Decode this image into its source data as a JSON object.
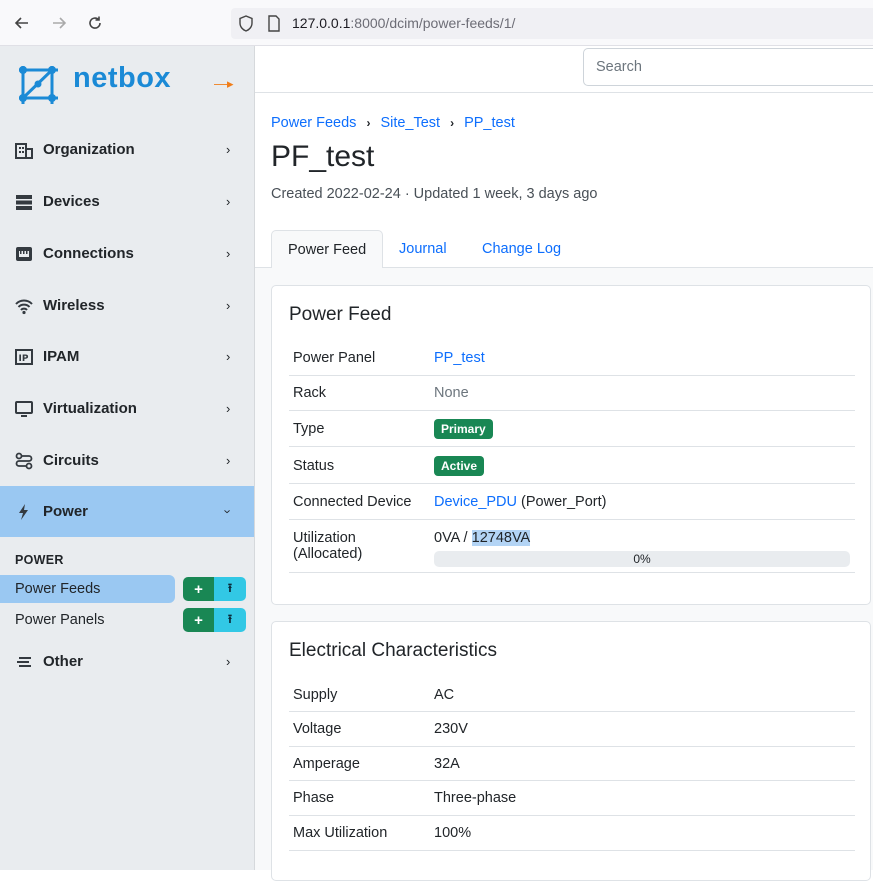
{
  "browser": {
    "url_host": "127.0.0.1",
    "url_rest": ":8000/dcim/power-feeds/1/"
  },
  "brand": {
    "name": "netbox"
  },
  "sidebar": {
    "items": [
      {
        "label": "Organization",
        "icon": "building-icon"
      },
      {
        "label": "Devices",
        "icon": "server-icon"
      },
      {
        "label": "Connections",
        "icon": "ethernet-icon"
      },
      {
        "label": "Wireless",
        "icon": "wifi-icon"
      },
      {
        "label": "IPAM",
        "icon": "ip-icon"
      },
      {
        "label": "Virtualization",
        "icon": "monitor-icon"
      },
      {
        "label": "Circuits",
        "icon": "circuit-icon"
      },
      {
        "label": "Power",
        "icon": "lightning-icon"
      },
      {
        "label": "Other",
        "icon": "lines-icon"
      }
    ],
    "section_title": "POWER",
    "sub_items": [
      {
        "label": "Power Feeds"
      },
      {
        "label": "Power Panels"
      }
    ]
  },
  "search": {
    "placeholder": "Search"
  },
  "breadcrumb": [
    "Power Feeds",
    "Site_Test",
    "PP_test"
  ],
  "page": {
    "title": "PF_test",
    "meta": "Created 2022-02-24 · Updated 1 week, 3 days ago"
  },
  "tabs": [
    "Power Feed",
    "Journal",
    "Change Log"
  ],
  "power_feed": {
    "title": "Power Feed",
    "power_panel_label": "Power Panel",
    "power_panel_value": "PP_test",
    "rack_label": "Rack",
    "rack_value": "None",
    "type_label": "Type",
    "type_value": "Primary",
    "status_label": "Status",
    "status_value": "Active",
    "connected_label": "Connected Device",
    "connected_device": "Device_PDU",
    "connected_port": "(Power_Port)",
    "util_label_1": "Utilization",
    "util_label_2": "(Allocated)",
    "util_used": "0VA / ",
    "util_total": "12748VA",
    "util_percent_text": "0%",
    "util_fraction": 0
  },
  "electrical": {
    "title": "Electrical Characteristics",
    "rows": [
      {
        "k": "Supply",
        "v": "AC"
      },
      {
        "k": "Voltage",
        "v": "230V"
      },
      {
        "k": "Amperage",
        "v": "32A"
      },
      {
        "k": "Phase",
        "v": "Three-phase"
      },
      {
        "k": "Max Utilization",
        "v": "100%"
      }
    ]
  },
  "colors": {
    "accent": "#0d6efd",
    "brand": "#1b8ad6",
    "success": "#198754",
    "info": "#32c8e5",
    "active_nav": "#9ac8f2"
  }
}
